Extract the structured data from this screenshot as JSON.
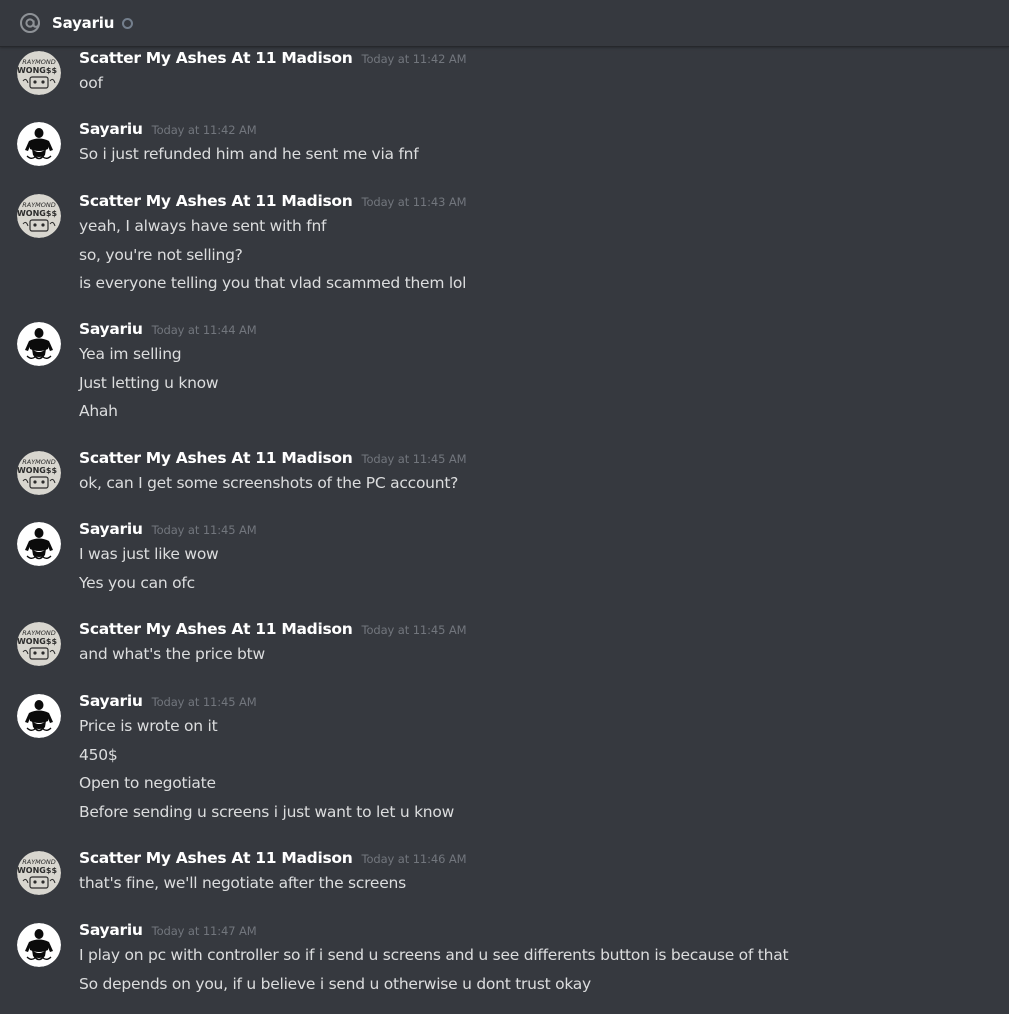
{
  "header": {
    "icon": "at-sign-icon",
    "title": "Sayariu",
    "status": "offline"
  },
  "colors": {
    "background": "#36393f",
    "username": "#ffffff",
    "timestamp": "#72767d",
    "message_text": "#dcddde",
    "status_offline": "#747f8d"
  },
  "messages": [
    {
      "author": "Scatter My Ashes At 11 Madison",
      "avatar": "raymond-wong-avatar",
      "timestamp": "Today at 11:42 AM",
      "lines": [
        "oof"
      ]
    },
    {
      "author": "Sayariu",
      "avatar": "sayariu-avatar",
      "timestamp": "Today at 11:42 AM",
      "lines": [
        "So i just refunded him and he sent me via fnf"
      ]
    },
    {
      "author": "Scatter My Ashes At 11 Madison",
      "avatar": "raymond-wong-avatar",
      "timestamp": "Today at 11:43 AM",
      "lines": [
        "yeah, I always have sent with fnf",
        "so, you're not selling?",
        "is everyone telling you that vlad scammed them lol"
      ]
    },
    {
      "author": "Sayariu",
      "avatar": "sayariu-avatar",
      "timestamp": "Today at 11:44 AM",
      "lines": [
        "Yea im selling",
        "Just letting u know",
        "Ahah"
      ]
    },
    {
      "author": "Scatter My Ashes At 11 Madison",
      "avatar": "raymond-wong-avatar",
      "timestamp": "Today at 11:45 AM",
      "lines": [
        "ok, can I get some screenshots of the PC account?"
      ]
    },
    {
      "author": "Sayariu",
      "avatar": "sayariu-avatar",
      "timestamp": "Today at 11:45 AM",
      "lines": [
        "I was just like wow",
        "Yes you can ofc"
      ]
    },
    {
      "author": "Scatter My Ashes At 11 Madison",
      "avatar": "raymond-wong-avatar",
      "timestamp": "Today at 11:45 AM",
      "lines": [
        "and what's the price btw"
      ]
    },
    {
      "author": "Sayariu",
      "avatar": "sayariu-avatar",
      "timestamp": "Today at 11:45 AM",
      "lines": [
        "Price is wrote on it",
        "450$",
        "Open to negotiate",
        "Before sending u screens i just want to let u know"
      ]
    },
    {
      "author": "Scatter My Ashes At 11 Madison",
      "avatar": "raymond-wong-avatar",
      "timestamp": "Today at 11:46 AM",
      "lines": [
        "that's fine, we'll negotiate after the screens"
      ]
    },
    {
      "author": "Sayariu",
      "avatar": "sayariu-avatar",
      "timestamp": "Today at 11:47 AM",
      "lines": [
        "I play on pc with controller so if i send u screens and u see differents button is because of that",
        "So depends on you, if u believe i send u otherwise u dont trust okay"
      ]
    }
  ]
}
